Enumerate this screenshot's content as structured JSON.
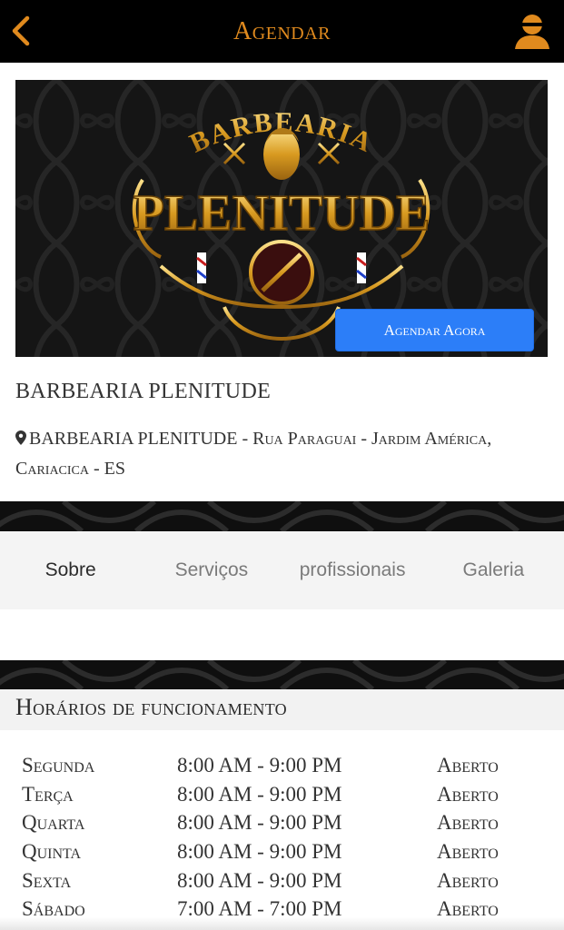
{
  "header": {
    "title": "Agendar",
    "back_icon": "chevron-left-icon",
    "profile_icon": "user-icon",
    "accent_color": "#e08a1e"
  },
  "banner": {
    "logo_top": "BARBEARIA",
    "logo_main": "PLENITUDE",
    "cta_label": "Agendar Agora",
    "cta_color": "#2c7ef8"
  },
  "shop": {
    "name": "BARBEARIA PLENITUDE",
    "address_icon": "map-pin-icon",
    "address": "BARBEARIA PLENITUDE - Rua Paraguai - Jardim América, Cariacica - ES"
  },
  "tabs": [
    {
      "label": "Sobre",
      "active": true
    },
    {
      "label": "Serviços",
      "active": false
    },
    {
      "label": "profissionais",
      "active": false
    },
    {
      "label": "Galeria",
      "active": false
    }
  ],
  "hours_section": {
    "title": "Horários de funcionamento",
    "rows": [
      {
        "day": "Segunda",
        "time": "8:00 AM - 9:00 PM",
        "status": "Aberto"
      },
      {
        "day": "Terça",
        "time": "8:00 AM - 9:00 PM",
        "status": "Aberto"
      },
      {
        "day": "Quarta",
        "time": "8:00 AM - 9:00 PM",
        "status": "Aberto"
      },
      {
        "day": "Quinta",
        "time": "8:00 AM - 9:00 PM",
        "status": "Aberto"
      },
      {
        "day": "Sexta",
        "time": "8:00 AM - 9:00 PM",
        "status": "Aberto"
      },
      {
        "day": "Sábado",
        "time": "7:00 AM - 7:00 PM",
        "status": "Aberto"
      }
    ]
  }
}
